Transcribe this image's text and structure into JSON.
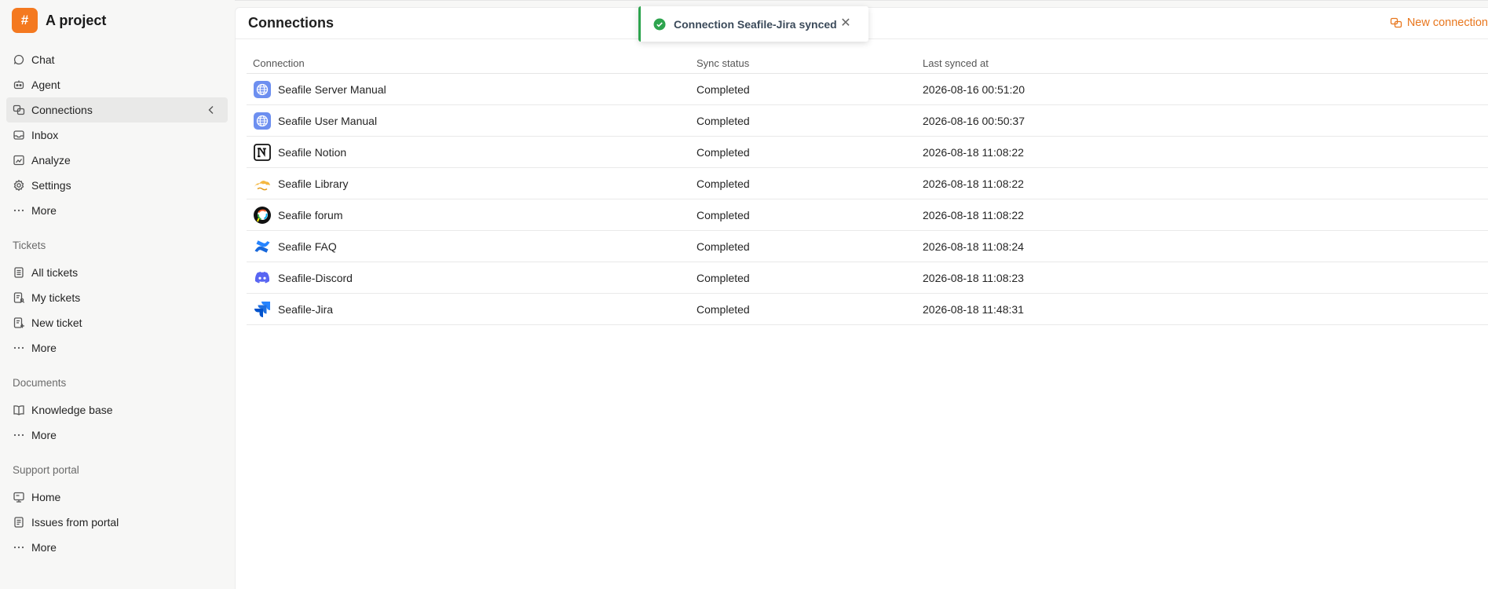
{
  "brand": {
    "logo_glyph": "#",
    "name": "A project",
    "accent": "#f47920"
  },
  "nav": [
    {
      "label": "Chat",
      "icon": "chat-icon"
    },
    {
      "label": "Agent",
      "icon": "bot-icon"
    },
    {
      "label": "Connections",
      "icon": "connections-icon",
      "active": true
    },
    {
      "label": "Inbox",
      "icon": "inbox-icon"
    },
    {
      "label": "Analyze",
      "icon": "chart-icon"
    },
    {
      "label": "Settings",
      "icon": "gear-icon"
    },
    {
      "label": "More",
      "icon": "more-icon"
    }
  ],
  "sections": {
    "tickets": {
      "title": "Tickets",
      "items": [
        {
          "label": "All tickets",
          "icon": "tickets-icon"
        },
        {
          "label": "My tickets",
          "icon": "my-tickets-icon"
        },
        {
          "label": "New ticket",
          "icon": "new-ticket-icon"
        },
        {
          "label": "More",
          "icon": "more-icon"
        }
      ]
    },
    "documents": {
      "title": "Documents",
      "items": [
        {
          "label": "Knowledge base",
          "icon": "book-icon"
        },
        {
          "label": "More",
          "icon": "more-icon"
        }
      ]
    },
    "support_portal": {
      "title": "Support portal",
      "items": [
        {
          "label": "Home",
          "icon": "home-icon"
        },
        {
          "label": "Issues from portal",
          "icon": "issues-icon"
        },
        {
          "label": "More",
          "icon": "more-icon"
        }
      ]
    }
  },
  "main": {
    "title": "Connections",
    "new_connection_label": "New connection",
    "accent": "#e8761d",
    "columns": [
      "Connection",
      "Sync status",
      "Last synced at"
    ],
    "rows": [
      {
        "name": "Seafile Server Manual",
        "icon": "globe-icon",
        "status": "Completed",
        "last": "2026-08-16 00:51:20"
      },
      {
        "name": "Seafile User Manual",
        "icon": "globe-icon",
        "status": "Completed",
        "last": "2026-08-16 00:50:37"
      },
      {
        "name": "Seafile Notion",
        "icon": "notion-icon",
        "status": "Completed",
        "last": "2026-08-18 11:08:22"
      },
      {
        "name": "Seafile Library",
        "icon": "seafile-icon",
        "status": "Completed",
        "last": "2026-08-18 11:08:22"
      },
      {
        "name": "Seafile forum",
        "icon": "discourse-icon",
        "status": "Completed",
        "last": "2026-08-18 11:08:22"
      },
      {
        "name": "Seafile FAQ",
        "icon": "confluence-icon",
        "status": "Completed",
        "last": "2026-08-18 11:08:24"
      },
      {
        "name": "Seafile-Discord",
        "icon": "discord-icon",
        "status": "Completed",
        "last": "2026-08-18 11:08:23"
      },
      {
        "name": "Seafile-Jira",
        "icon": "jira-icon",
        "status": "Completed",
        "last": "2026-08-18 11:48:31"
      }
    ]
  },
  "toast": {
    "message": "Connection Seafile-Jira synced",
    "success_color": "#2da44e",
    "close_glyph": "✕"
  }
}
